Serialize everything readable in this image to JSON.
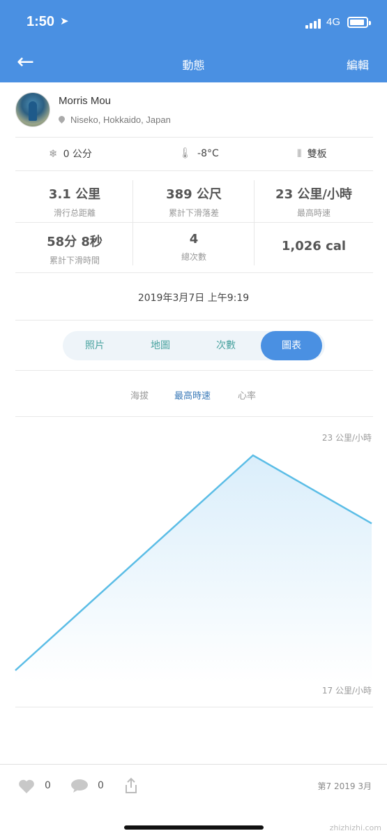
{
  "status_bar": {
    "time": "1:50",
    "network": "4G"
  },
  "nav": {
    "back_icon": "back-arrow-icon",
    "title": "動態",
    "edit_label": "編輯"
  },
  "profile": {
    "name": "Morris Mou",
    "location": "Niseko, Hokkaido, Japan"
  },
  "conditions": [
    {
      "icon": "snowflake-icon",
      "text": "0 公分"
    },
    {
      "icon": "thermometer-icon",
      "text": "-8°C"
    },
    {
      "icon": "ski-icon",
      "text": "雙板"
    }
  ],
  "stats": [
    {
      "value": "3.1 公里",
      "label": "滑行总距離"
    },
    {
      "value": "389 公尺",
      "label": "累計下滑落差"
    },
    {
      "value": "23 公里/小時",
      "label": "最高時速"
    },
    {
      "value": "58分 8秒",
      "label": "累計下滑時間"
    },
    {
      "value": "4",
      "label": "總次數"
    },
    {
      "value": "1,026 cal",
      "label": ""
    }
  ],
  "datetime": "2019年3月7日 上午9:19",
  "segments": [
    {
      "label": "照片",
      "active": false
    },
    {
      "label": "地圖",
      "active": false
    },
    {
      "label": "次數",
      "active": false
    },
    {
      "label": "圖表",
      "active": true
    }
  ],
  "subtabs": [
    {
      "label": "海拔",
      "active": false
    },
    {
      "label": "最高時速",
      "active": true
    },
    {
      "label": "心率",
      "active": false
    }
  ],
  "chart_data": {
    "type": "area",
    "title": "",
    "x": [
      1,
      2,
      3
    ],
    "values": [
      17,
      23,
      21.1
    ],
    "ylim": [
      17,
      23
    ],
    "ymax_label": "23 公里/小時",
    "ymin_label": "17 公里/小時",
    "grid": false,
    "line_color": "#5bbde6",
    "fill_color": "#d6ecfa"
  },
  "bottom": {
    "likes": "0",
    "comments": "0",
    "week_label": "第7 2019 3月"
  },
  "watermark": "zhizhizhi.com",
  "colors": {
    "accent": "#4a90e2",
    "header": "#4a90e2"
  }
}
